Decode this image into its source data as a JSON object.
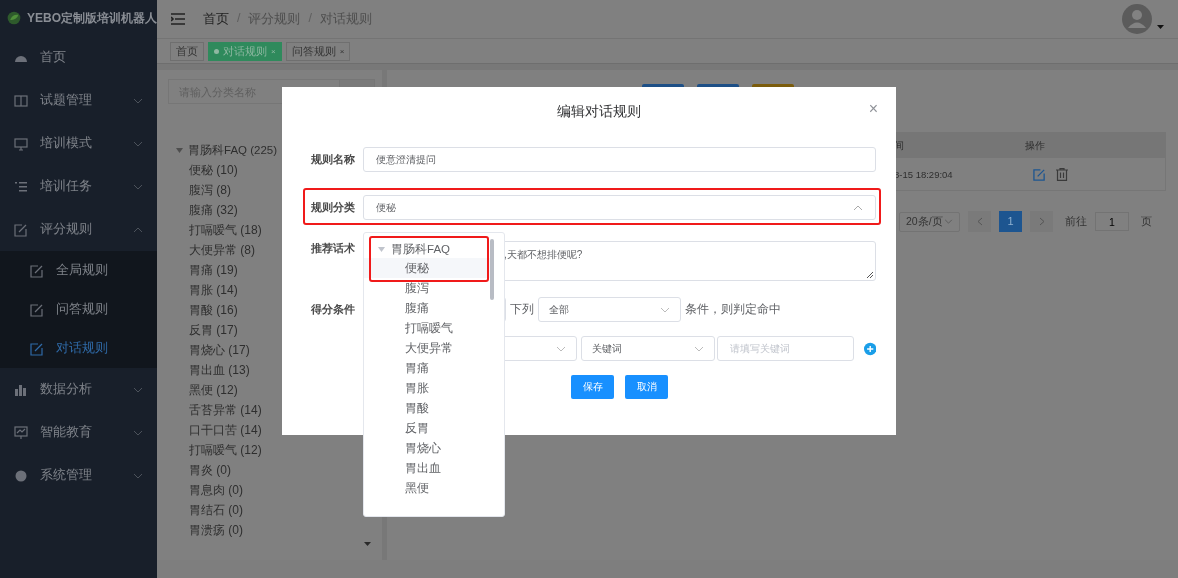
{
  "app": {
    "title": "YEBO定制版培训机器人"
  },
  "sidebar": {
    "items": [
      {
        "label": "首页",
        "kind": "link"
      },
      {
        "label": "试题管理",
        "kind": "group",
        "expanded": false
      },
      {
        "label": "培训模式",
        "kind": "group",
        "expanded": false
      },
      {
        "label": "培训任务",
        "kind": "group",
        "expanded": false
      },
      {
        "label": "评分规则",
        "kind": "group",
        "expanded": true,
        "children": [
          {
            "label": "全局规则",
            "selected": false
          },
          {
            "label": "问答规则",
            "selected": false
          },
          {
            "label": "对话规则",
            "selected": true
          }
        ]
      },
      {
        "label": "数据分析",
        "kind": "group",
        "expanded": false
      },
      {
        "label": "智能教育",
        "kind": "group",
        "expanded": false
      },
      {
        "label": "系统管理",
        "kind": "group",
        "expanded": false
      }
    ]
  },
  "breadcrumb": {
    "separator": "/",
    "items": [
      "首页",
      "评分规则",
      "对话规则"
    ]
  },
  "tags": [
    {
      "label": "首页",
      "selected": false
    },
    {
      "label": "对话规则",
      "selected": true,
      "close": "×"
    },
    {
      "label": "问答规则",
      "selected": false,
      "close": "×"
    }
  ],
  "category_panel": {
    "search_placeholder": "请输入分类名称",
    "tree": [
      {
        "label": "胃肠科FAQ (225)",
        "expanded": true,
        "children": [
          {
            "label": "便秘 (10)"
          },
          {
            "label": "腹泻 (8)"
          },
          {
            "label": "腹痛 (32)"
          },
          {
            "label": "打嗝嗳气 (18)"
          },
          {
            "label": "大便异常 (8)"
          },
          {
            "label": "胃痛 (19)"
          },
          {
            "label": "胃胀 (14)"
          },
          {
            "label": "胃酸 (16)"
          },
          {
            "label": "反胃 (17)"
          },
          {
            "label": "胃烧心 (17)"
          },
          {
            "label": "胃出血 (13)"
          },
          {
            "label": "黑便 (12)"
          },
          {
            "label": "舌苔异常 (14)"
          },
          {
            "label": "口干口苦 (14)"
          },
          {
            "label": "打嗝嗳气 (12)"
          },
          {
            "label": "胃炎 (0)"
          },
          {
            "label": "胃息肉 (0)"
          },
          {
            "label": "胃结石 (0)"
          },
          {
            "label": "胃溃疡 (0)"
          }
        ]
      }
    ]
  },
  "table": {
    "columns": [
      "间",
      "操作"
    ],
    "rows": [
      {
        "time": "8-15 18:29:04"
      }
    ]
  },
  "pagination": {
    "page_size": "20条/页",
    "pages": [
      {
        "label": "1",
        "selected": true
      }
    ],
    "goto_label": "前往",
    "goto_value": "1",
    "suffix": "页"
  },
  "dialog": {
    "title": "编辑对话规则",
    "close": "×",
    "name_label": "规则名称",
    "name_value": "便意澄清提问",
    "category_label": "规则分类",
    "category_value": "便秘",
    "category_open": true,
    "script_label": "推荐话术",
    "script_value": ",天都不想排便呢?",
    "score_label": "得分条件",
    "cond_text_1": "下列",
    "cond_select": "全部",
    "cond_text_2": "条件，则判定命中",
    "rule_type": "关键词",
    "keyword_placeholder": "请填写关键词",
    "buttons": [
      "保存",
      "取消"
    ],
    "dropdown": [
      {
        "label": "胃肠科FAQ",
        "expanded": true,
        "children": [
          {
            "label": "便秘",
            "selected": true
          },
          {
            "label": "腹泻",
            "selected": false
          },
          {
            "label": "腹痛",
            "selected": false
          },
          {
            "label": "打嗝嗳气",
            "selected": false
          },
          {
            "label": "大便异常",
            "selected": false
          },
          {
            "label": "胃痛",
            "selected": false
          },
          {
            "label": "胃胀",
            "selected": false
          },
          {
            "label": "胃酸",
            "selected": false
          },
          {
            "label": "反胃",
            "selected": false
          },
          {
            "label": "胃烧心",
            "selected": false
          },
          {
            "label": "胃出血",
            "selected": false
          },
          {
            "label": "黑便",
            "selected": false
          }
        ]
      }
    ]
  }
}
